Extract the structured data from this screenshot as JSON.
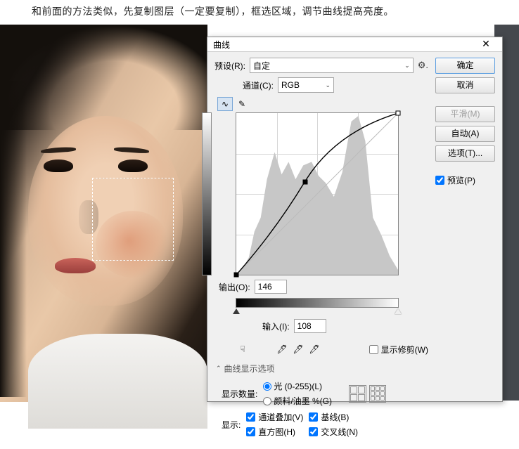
{
  "instruction": "和前面的方法类似，先复制图层（一定要复制），框选区域，调节曲线提高亮度。",
  "dialog": {
    "title": "曲线",
    "preset_label": "预设(R):",
    "preset_value": "自定",
    "channel_label": "通道(C):",
    "channel_value": "RGB",
    "output_label": "输出(O):",
    "output_value": "146",
    "input_label": "输入(I):",
    "input_value": "108",
    "show_clipping_label": "显示修剪(W)",
    "curve_options_title": "曲线显示选项",
    "display_amount_label": "显示数量:",
    "radio_light": "光 (0-255)(L)",
    "radio_pigment": "颜料/油墨 %(G)",
    "show_label": "显示:",
    "chk_channel_overlay": "通道叠加(V)",
    "chk_histogram": "直方图(H)",
    "chk_baseline": "基线(B)",
    "chk_intersection": "交叉线(N)"
  },
  "buttons": {
    "ok": "确定",
    "cancel": "取消",
    "smooth": "平滑(M)",
    "auto": "自动(A)",
    "options": "选项(T)...",
    "preview": "预览(P)"
  },
  "icons": {
    "close": "✕",
    "gear": "⚙",
    "chevron_down": "⌄",
    "curve_tool": "〰",
    "pencil_tool": "✎",
    "hand_tool": "☟",
    "eyedrop": "💧"
  },
  "chart_data": {
    "type": "line",
    "title": "RGB Curve",
    "xlabel": "输入",
    "ylabel": "输出",
    "xlim": [
      0,
      255
    ],
    "ylim": [
      0,
      255
    ],
    "series": [
      {
        "name": "curve",
        "x": [
          0,
          108,
          255
        ],
        "y": [
          0,
          146,
          255
        ]
      }
    ],
    "histogram_peaks_x": [
      20,
      55,
      90,
      110,
      135,
      175,
      200
    ],
    "histogram_peaks_y": [
      25,
      85,
      140,
      160,
      130,
      230,
      60
    ]
  }
}
